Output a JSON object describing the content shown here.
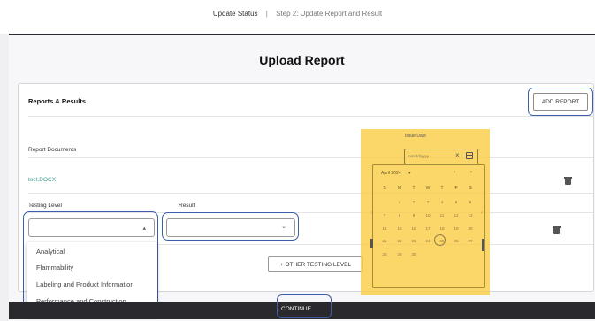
{
  "breadcrumb": {
    "step1": "Update Status",
    "separator": "|",
    "step2": "Step 2: Update Report and Result"
  },
  "page": {
    "title": "Upload Report"
  },
  "card": {
    "title": "Reports & Results",
    "add_report_label": "ADD REPORT",
    "documents_label": "Report Documents",
    "file_name": "test.DOCX",
    "testing_level_label": "Testing Level",
    "result_label": "Result",
    "testing_level_value": "",
    "result_value": "",
    "other_level_label": "+ OTHER TESTING LEVEL"
  },
  "testing_level_options": [
    "Analytical",
    "Flammability",
    "Labeling and Product Information",
    "Performance and Construction"
  ],
  "footer": {
    "continue_label": "CONTINUE"
  },
  "date_picker": {
    "label": "Issue Date",
    "placeholder": "mm/dd/yyyy",
    "month": "April 2024",
    "weekdays": [
      "S",
      "M",
      "T",
      "W",
      "T",
      "F",
      "S"
    ],
    "weeks": [
      [
        "",
        "1",
        "2",
        "3",
        "4",
        "5",
        "6"
      ],
      [
        "7",
        "8",
        "9",
        "10",
        "11",
        "12",
        "13"
      ],
      [
        "14",
        "15",
        "16",
        "17",
        "18",
        "19",
        "20"
      ],
      [
        "21",
        "22",
        "23",
        "24",
        "25",
        "26",
        "27"
      ],
      [
        "28",
        "29",
        "30",
        "",
        "",
        "",
        ""
      ]
    ],
    "today": "25",
    "highlight_color": "#facd48"
  },
  "colors": {
    "accent_ring": "#3b5ea8",
    "file_link": "#3a9e8f",
    "dark_bar": "#2a2a2e"
  },
  "icons": {
    "caret": "▴",
    "caret_down": "⌄",
    "prev": "‹",
    "next": "›",
    "clear": "×",
    "trash": "trash-icon",
    "calendar": "calendar-icon"
  }
}
